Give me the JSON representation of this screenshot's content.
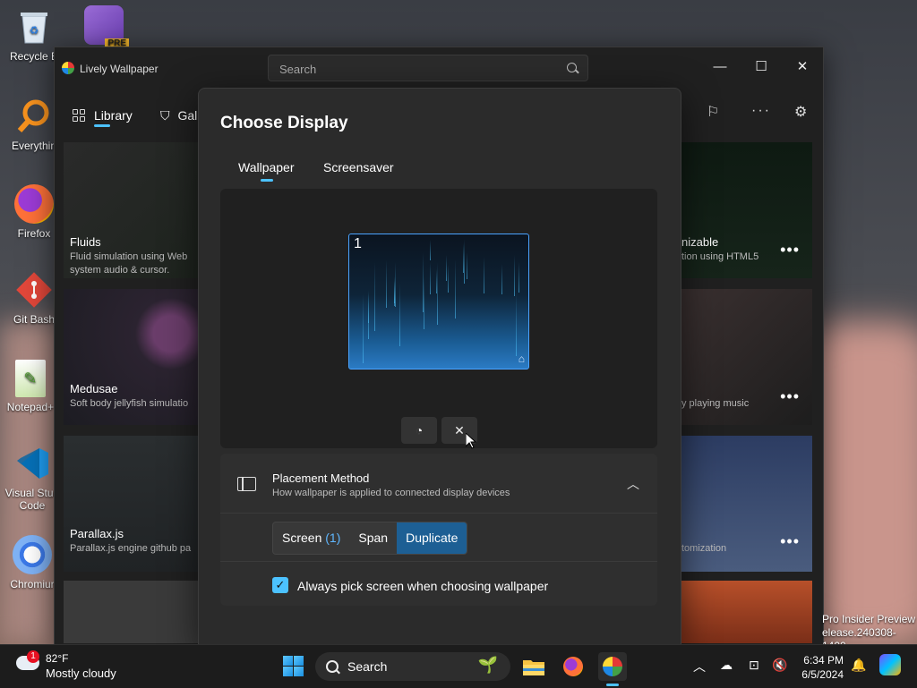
{
  "desktop": {
    "icons": [
      {
        "label": "Recycle B",
        "icon": "recycle-bin-icon"
      },
      {
        "label": "Everythin",
        "icon": "everything-search-icon"
      },
      {
        "label": "Firefox",
        "icon": "firefox-icon"
      },
      {
        "label": "Git Bash",
        "icon": "git-bash-icon"
      },
      {
        "label": "Notepad+",
        "icon": "notepad-plus-icon"
      },
      {
        "label": "Visual Stud Code",
        "icon": "vscode-icon"
      },
      {
        "label": "Chromiur",
        "icon": "chromium-icon"
      }
    ],
    "vs_badge": "PRE",
    "watermark_line1": "Pro Insider Preview",
    "watermark_line2": "elease.240308-1400"
  },
  "window": {
    "title": "Lively Wallpaper",
    "search_placeholder": "Search",
    "nav": {
      "library": "Library",
      "gallery": "Gal"
    },
    "cards_left": [
      {
        "title": "Fluids",
        "desc1": "Fluid simulation using Web",
        "desc2": "system audio & cursor."
      },
      {
        "title": "Medusae",
        "desc1": "Soft body jellyfish simulatio"
      },
      {
        "title": "Parallax.js",
        "desc1": "Parallax.js engine github pa"
      }
    ],
    "cards_right": [
      {
        "title": "nizable",
        "desc1": "tion using HTML5"
      },
      {
        "title": "",
        "desc1": "y playing music"
      },
      {
        "title": "",
        "desc1": "tomization"
      }
    ],
    "more_glyph": "•••"
  },
  "dialog": {
    "title": "Choose Display",
    "tabs": [
      "Wallpaper",
      "Screensaver"
    ],
    "active_tab": "Wallpaper",
    "monitor_number": "1",
    "placement": {
      "title": "Placement Method",
      "subtitle": "How wallpaper is applied to connected display devices",
      "options": [
        "Screen",
        "(1)",
        "Span",
        "Duplicate"
      ],
      "selected": "Duplicate"
    },
    "checkbox_label": "Always pick screen when choosing wallpaper",
    "checkbox_checked": true
  },
  "taskbar": {
    "weather_temp": "82°F",
    "weather_desc": "Mostly cloudy",
    "weather_badge": "1",
    "search_label": "Search",
    "time": "6:34 PM",
    "date": "6/5/2024"
  },
  "colors": {
    "accent": "#4cc2ff",
    "selected_segment": "#1d5f94"
  }
}
